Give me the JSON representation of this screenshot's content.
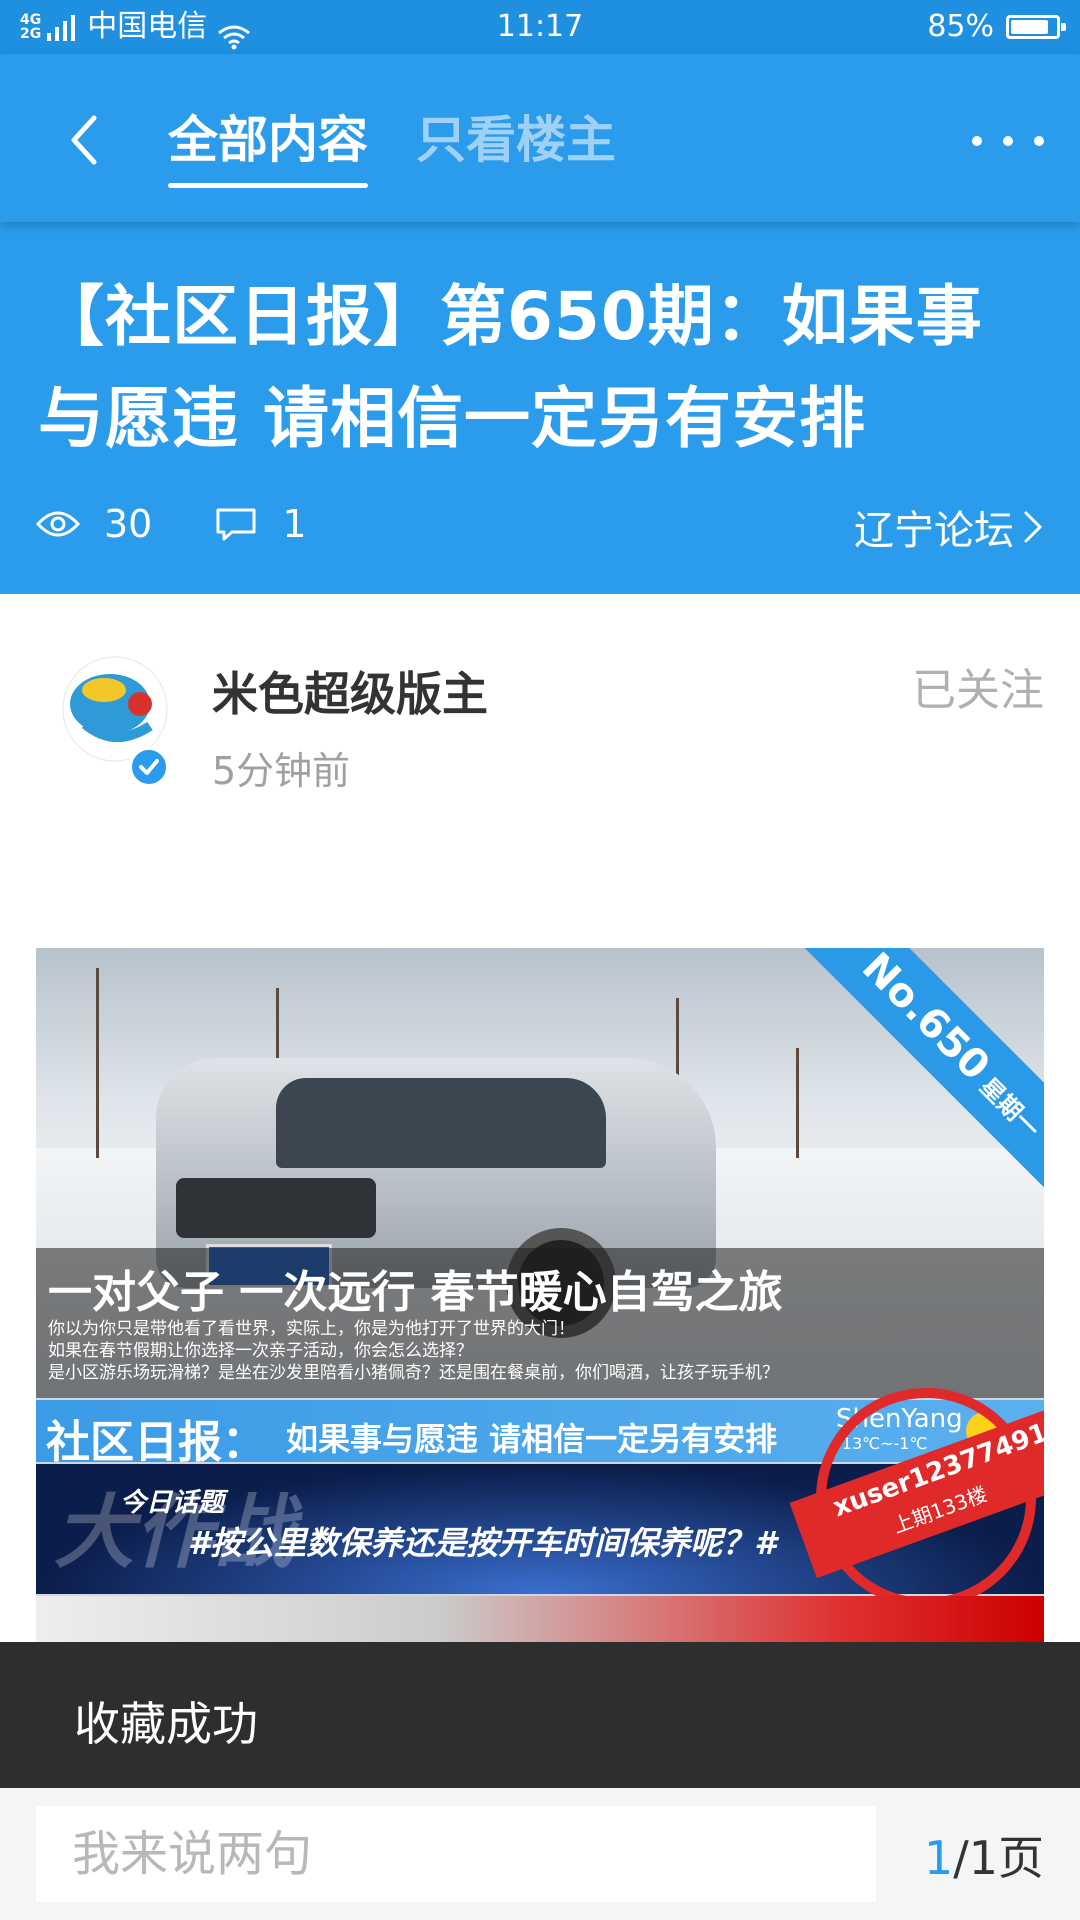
{
  "status_bar": {
    "network": "4G\n2G",
    "carrier": "中国电信",
    "time": "11:17",
    "battery": "85%",
    "battery_level": 0.85
  },
  "header": {
    "tabs": [
      {
        "label": "全部内容",
        "active": true
      },
      {
        "label": "只看楼主",
        "active": false
      }
    ]
  },
  "post": {
    "title": "【社区日报】第650期：如果事与愿违 请相信一定另有安排",
    "views": "30",
    "comments": "1",
    "forum": "辽宁论坛"
  },
  "author": {
    "name": "米色超级版主",
    "time": "5分钟前",
    "follow_label": "已关注"
  },
  "banner": {
    "issue": "No.650",
    "weekday": "星期一",
    "headline": "一对父子 一次远行 春节暖心自驾之旅",
    "lines": [
      "你以为你只是带他看了看世界，实际上，你是为他打开了世界的大门！",
      "如果在春节假期让你选择一次亲子活动，你会怎么选择？",
      "是小区游乐场玩滑梯？是坐在沙发里陪看小猪佩奇？还是围在餐桌前，你们喝酒，让孩子玩手机？"
    ],
    "daily_label": "社区日报：",
    "daily_subtitle": "如果事与愿违 请相信一定另有安排",
    "city": "ShenYang",
    "temperature": "-13℃~-1℃",
    "topic_label": "今日话题",
    "topic": "#按公里数保养还是按开车时间保养呢？#",
    "stamp_user": "xuser12377491",
    "stamp_floor": "上期133楼"
  },
  "toast": {
    "text": "收藏成功"
  },
  "bottom_bar": {
    "input_placeholder": "我来说两句",
    "page_current": "1",
    "page_total": "/1页"
  },
  "colors": {
    "primary": "#2b9bec",
    "status_bar": "#1f8fe0",
    "toast_bg": "#2e2e2e"
  }
}
